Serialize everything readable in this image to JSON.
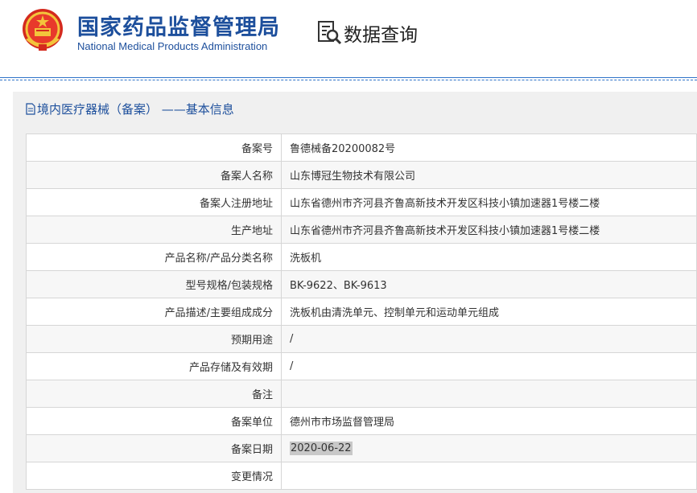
{
  "header": {
    "org_name_cn": "国家药品监督管理局",
    "org_name_en": "National Medical Products Administration",
    "query_label": "数据查询"
  },
  "section": {
    "title": "境内医疗器械（备案） ——基本信息"
  },
  "rows": [
    {
      "label": "备案号",
      "value": "鲁德械备20200082号"
    },
    {
      "label": "备案人名称",
      "value": "山东博冠生物技术有限公司"
    },
    {
      "label": "备案人注册地址",
      "value": "山东省德州市齐河县齐鲁高新技术开发区科技小镇加速器1号楼二楼"
    },
    {
      "label": "生产地址",
      "value": "山东省德州市齐河县齐鲁高新技术开发区科技小镇加速器1号楼二楼"
    },
    {
      "label": "产品名称/产品分类名称",
      "value": "洗板机"
    },
    {
      "label": "型号规格/包装规格",
      "value": "BK-9622、BK-9613"
    },
    {
      "label": "产品描述/主要组成成分",
      "value": "洗板机由清洗单元、控制单元和运动单元组成"
    },
    {
      "label": "预期用途",
      "value": "/"
    },
    {
      "label": "产品存储及有效期",
      "value": "/"
    },
    {
      "label": "备注",
      "value": ""
    },
    {
      "label": "备案单位",
      "value": "德州市市场监督管理局"
    },
    {
      "label": "备案日期",
      "value": "2020-06-22"
    },
    {
      "label": "变更情况",
      "value": ""
    }
  ]
}
